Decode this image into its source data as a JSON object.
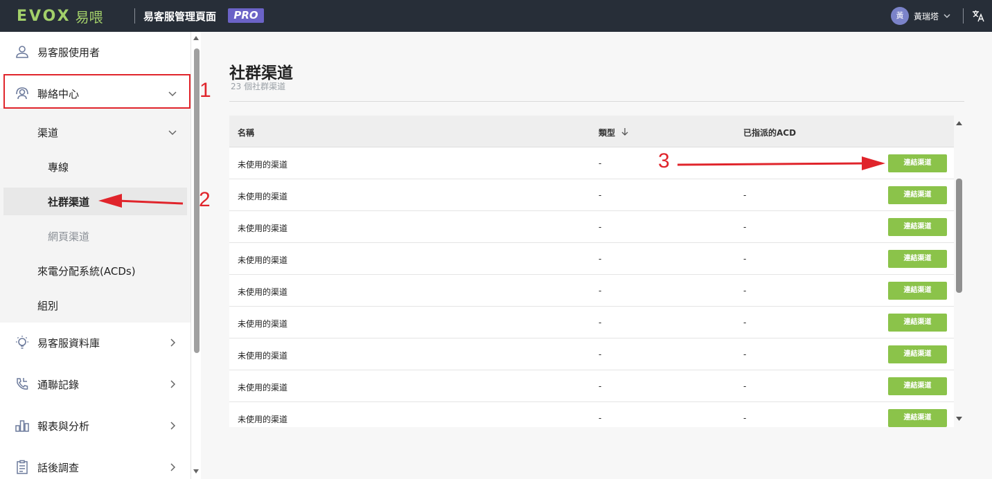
{
  "header": {
    "logo_text": "EVOX",
    "logo_cn": "易喂",
    "app_title": "易客服管理頁面",
    "pro_badge": "PRO",
    "user_avatar": "黃",
    "user_name": "黃瑞塔",
    "lang_icon": "translate-icon"
  },
  "sidebar": {
    "items": [
      {
        "label": "易客服使用者",
        "icon": "user-icon"
      },
      {
        "label": "聯絡中心",
        "icon": "headset-icon"
      },
      {
        "label": "渠道"
      },
      {
        "label": "專線"
      },
      {
        "label": "社群渠道"
      },
      {
        "label": "網頁渠道"
      },
      {
        "label": "來電分配系統(ACDs)"
      },
      {
        "label": "組別"
      },
      {
        "label": "易客服資料庫",
        "icon": "lightbulb-icon"
      },
      {
        "label": "通聯記錄",
        "icon": "phone-log-icon"
      },
      {
        "label": "報表與分析",
        "icon": "bar-chart-icon"
      },
      {
        "label": "話後調查",
        "icon": "clipboard-icon"
      }
    ]
  },
  "annotations": {
    "a1": "1",
    "a2": "2",
    "a3": "3"
  },
  "main": {
    "title": "社群渠道",
    "subtitle": "23 個社群渠道",
    "table": {
      "headers": [
        "名稱",
        "類型",
        "已指派的ACD"
      ],
      "button_label": "連結渠道",
      "rows": [
        {
          "name": "未使用的渠道",
          "type": "-",
          "acd": ""
        },
        {
          "name": "未使用的渠道",
          "type": "-",
          "acd": "-"
        },
        {
          "name": "未使用的渠道",
          "type": "-",
          "acd": "-"
        },
        {
          "name": "未使用的渠道",
          "type": "-",
          "acd": "-"
        },
        {
          "name": "未使用的渠道",
          "type": "-",
          "acd": "-"
        },
        {
          "name": "未使用的渠道",
          "type": "-",
          "acd": "-"
        },
        {
          "name": "未使用的渠道",
          "type": "-",
          "acd": "-"
        },
        {
          "name": "未使用的渠道",
          "type": "-",
          "acd": "-"
        },
        {
          "name": "未使用的渠道",
          "type": "-",
          "acd": "-"
        }
      ]
    }
  },
  "colors": {
    "accent_green": "#8bc34a",
    "topbar": "#272e38",
    "pro": "#6b63c7",
    "annotation_red": "#e0242b"
  }
}
